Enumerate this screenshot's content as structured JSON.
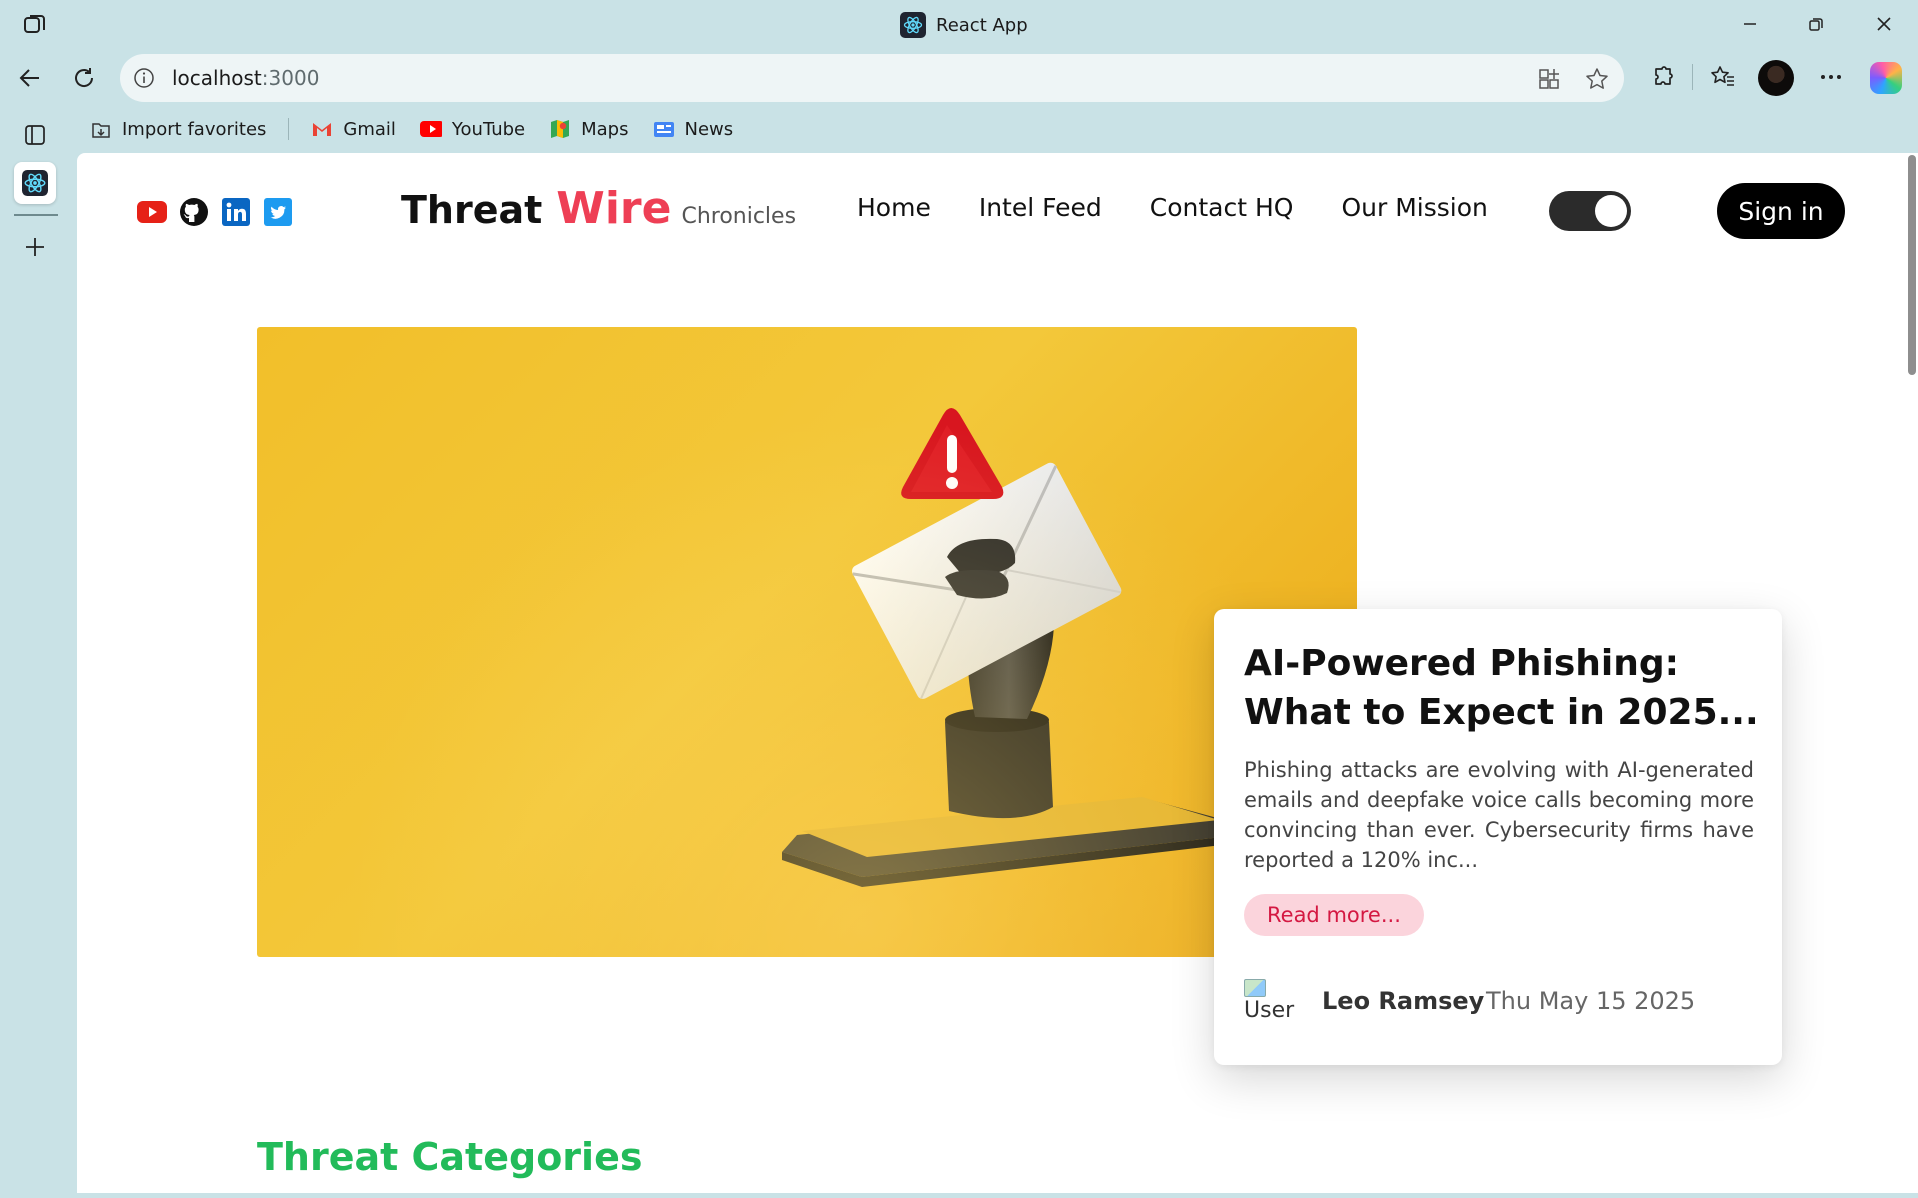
{
  "browser": {
    "tab_title": "React App",
    "url_host": "localhost",
    "url_port": ":3000",
    "favorites": [
      {
        "label": "Import favorites",
        "icon": "import-favorites-icon"
      },
      {
        "label": "Gmail",
        "icon": "gmail-icon"
      },
      {
        "label": "YouTube",
        "icon": "youtube-icon"
      },
      {
        "label": "Maps",
        "icon": "maps-icon"
      },
      {
        "label": "News",
        "icon": "news-icon"
      }
    ]
  },
  "site": {
    "brand": {
      "part1": "Threat",
      "part2": "Wire",
      "part3": "Chronicles"
    },
    "social_icons": [
      "youtube-icon",
      "github-icon",
      "linkedin-icon",
      "twitter-icon"
    ],
    "nav": [
      "Home",
      "Intel Feed",
      "Contact HQ",
      "Our Mission"
    ],
    "signin_label": "Sign in",
    "theme_toggle_on": true
  },
  "featured": {
    "title": "AI-Powered Phishing: What to Expect in 2025...",
    "excerpt": "Phishing attacks are evolving with AI-generated emails and deepfake voice calls becoming more convincing than ever. Cybersecurity firms have reported a 120% inc...",
    "read_more": "Read more...",
    "user_img_alt": "User",
    "author": "Leo Ramsey",
    "date": "Thu May 15 2025"
  },
  "sections": {
    "threat_categories": "Threat Categories"
  },
  "colors": {
    "accent_red": "#ee3f55",
    "accent_green": "#22bb5a",
    "hero_yellow": "#f2bf2a",
    "browser_chrome": "#c9e2e6"
  }
}
